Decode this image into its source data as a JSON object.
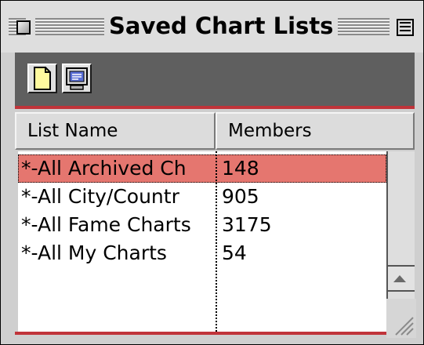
{
  "window": {
    "title": "Saved Chart Lists"
  },
  "toolbar": {
    "buttons": [
      {
        "icon": "new-document-icon"
      },
      {
        "icon": "computer-monitor-icon"
      }
    ]
  },
  "columns": {
    "name_header": "List Name",
    "members_header": "Members"
  },
  "rows": [
    {
      "name": "*-All Archived Ch",
      "members": "148",
      "selected": true
    },
    {
      "name": "*-All City/Countr",
      "members": "905",
      "selected": false
    },
    {
      "name": "*-All Fame Charts",
      "members": "3175",
      "selected": false
    },
    {
      "name": "*-All My Charts",
      "members": "54",
      "selected": false
    }
  ],
  "colors": {
    "accent_red": "#c0343a",
    "selection": "#e5766f",
    "toolbar_bg": "#5f5f5f"
  }
}
